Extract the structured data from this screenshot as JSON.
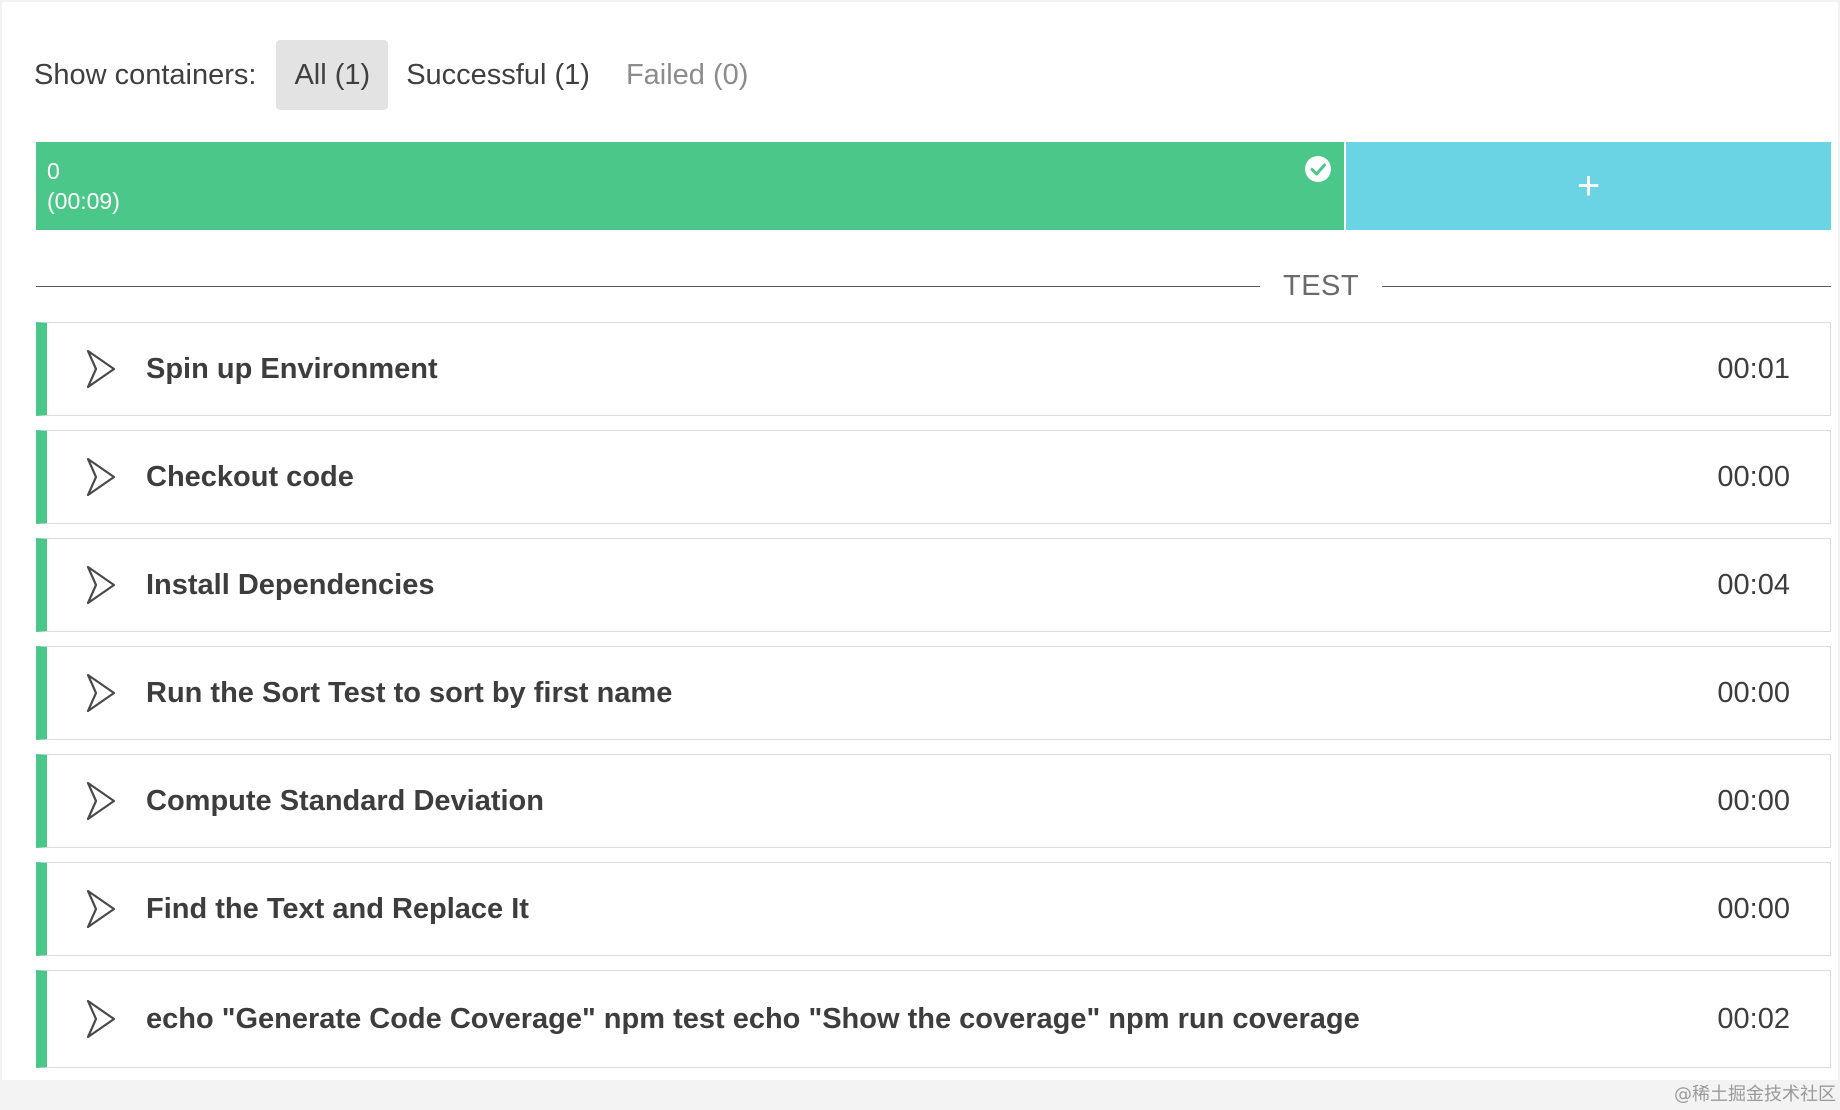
{
  "filters": {
    "label": "Show containers:",
    "all": "All (1)",
    "successful": "Successful (1)",
    "failed": "Failed (0)"
  },
  "container": {
    "id": "0",
    "duration": "(00:09)",
    "status": "success",
    "status_icon": "check-circle-icon",
    "add_label": "+"
  },
  "colors": {
    "success": "#4cc78a",
    "add": "#6ad4e4"
  },
  "section": {
    "title": "TEST"
  },
  "steps": [
    {
      "title": "Spin up Environment",
      "duration": "00:01"
    },
    {
      "title": "Checkout code",
      "duration": "00:00"
    },
    {
      "title": "Install Dependencies",
      "duration": "00:04"
    },
    {
      "title": "Run the Sort Test to sort by first name",
      "duration": "00:00"
    },
    {
      "title": "Compute Standard Deviation",
      "duration": "00:00"
    },
    {
      "title": "Find the Text and Replace It",
      "duration": "00:00"
    },
    {
      "title": "echo \"Generate Code Coverage\" npm test echo \"Show the coverage\" npm run coverage",
      "duration": "00:02"
    }
  ],
  "watermark": "@稀土掘金技术社区"
}
